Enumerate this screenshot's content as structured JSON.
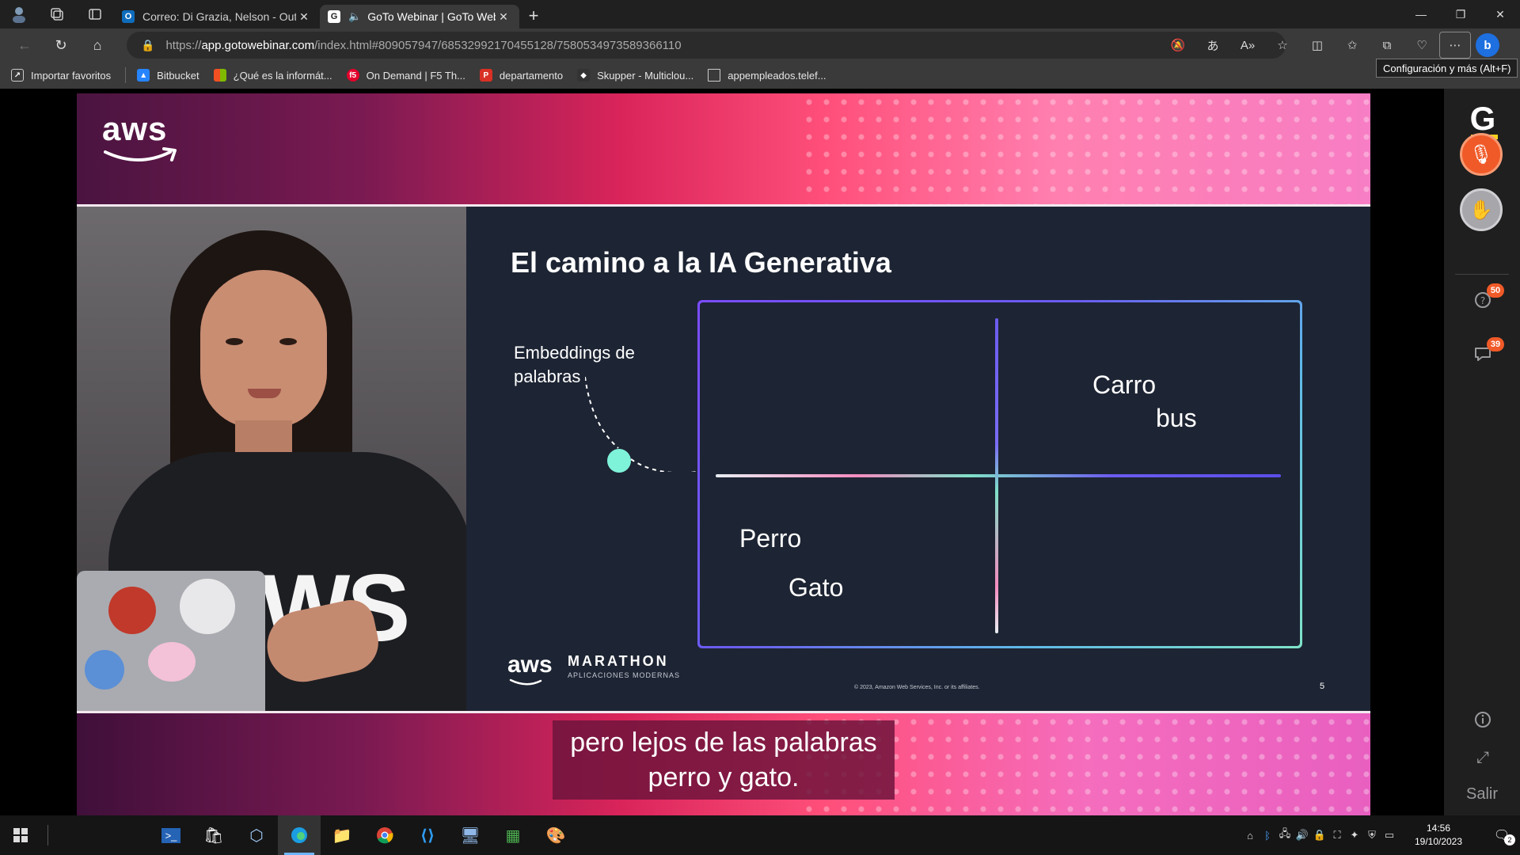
{
  "browser": {
    "tabs": [
      {
        "title": "Correo: Di Grazia, Nelson - Outlook",
        "favicon": "outlook-icon",
        "active": false
      },
      {
        "title": "GoTo Webinar | GoTo Webinar",
        "favicon": "goto-icon",
        "active": true,
        "audio": true
      }
    ],
    "new_tab_label": "+",
    "url_prefix": "https://",
    "url_host": "app.gotowebinar.com",
    "url_path": "/index.html#809057947/68532992170455128/7580534973589366110",
    "tooltip": "Configuración y más (Alt+F)",
    "favorites": [
      {
        "label": "Importar favoritos",
        "icon": "import-icon",
        "color": "#555555"
      },
      {
        "label": "Bitbucket",
        "icon": "bitbucket-icon",
        "color": "#2684ff"
      },
      {
        "label": "¿Qué es la informát...",
        "icon": "windows-icon",
        "color": "#f25022"
      },
      {
        "label": "On Demand | F5 Th...",
        "icon": "f5-icon",
        "color": "#e4002b"
      },
      {
        "label": "departamento",
        "icon": "pdf-icon",
        "color": "#d93025"
      },
      {
        "label": "Skupper - Multiclou...",
        "icon": "skupper-icon",
        "color": "#333333"
      },
      {
        "label": "appempleados.telef...",
        "icon": "page-icon",
        "color": "#555555"
      }
    ]
  },
  "video": {
    "brand": "aws",
    "slide": {
      "title": "El camino a la IA Generativa",
      "embeddings_label_1": "Embeddings de",
      "embeddings_label_2": "palabras",
      "words": {
        "carro": "Carro",
        "bus": "bus",
        "perro": "Perro",
        "gato": "Gato"
      },
      "footer_brand": "aws",
      "event_name": "MARATHON",
      "event_subtitle": "APLICACIONES MODERNAS",
      "copyright": "© 2023, Amazon Web Services, Inc. or its affiliates.",
      "page_number": "5"
    },
    "shirt_text": "WS",
    "caption_line_1": "pero lejos de las palabras",
    "caption_line_2": "perro y gato."
  },
  "goto_panel": {
    "questions_count": "50",
    "chat_count": "39",
    "exit_label": "Salir"
  },
  "taskbar": {
    "time": "14:56",
    "date": "19/10/2023",
    "notifications": "2"
  }
}
